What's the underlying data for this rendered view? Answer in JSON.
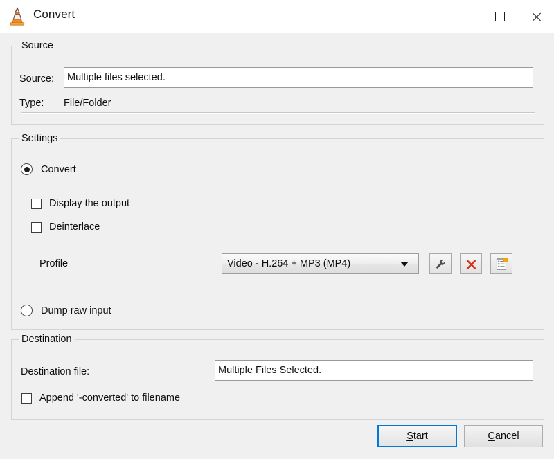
{
  "window": {
    "title": "Convert",
    "icon": "vlc-cone-icon",
    "controls": {
      "minimize": "minimize-icon",
      "maximize": "maximize-icon",
      "close": "close-icon"
    }
  },
  "source_group": {
    "legend": "Source",
    "source_label": "Source:",
    "source_value": "Multiple files selected.",
    "type_label": "Type:",
    "type_value": "File/Folder"
  },
  "settings_group": {
    "legend": "Settings",
    "convert_radio": {
      "label": "Convert",
      "selected": true
    },
    "display_output_checkbox": {
      "label": "Display the output",
      "checked": false
    },
    "deinterlace_checkbox": {
      "label": "Deinterlace",
      "checked": false
    },
    "profile_label": "Profile",
    "profile_value": "Video - H.264 + MP3 (MP4)",
    "profile_buttons": {
      "edit": "wrench-icon",
      "delete": "red-x-icon",
      "create": "new-profile-icon"
    },
    "dump_raw_radio": {
      "label": "Dump raw input",
      "selected": false
    }
  },
  "destination_group": {
    "legend": "Destination",
    "destination_label": "Destination file:",
    "destination_value": "Multiple Files Selected.",
    "append_checkbox": {
      "label": "Append '-converted' to filename",
      "checked": false
    }
  },
  "footer": {
    "start_label_accel": "S",
    "start_label_rest": "tart",
    "cancel_label_accel": "C",
    "cancel_label_rest": "ancel"
  },
  "colors": {
    "focus_blue": "#0078d7",
    "delete_red": "#d4301a",
    "badge_orange": "#f7a700",
    "window_bg": "#f0f0f0"
  }
}
